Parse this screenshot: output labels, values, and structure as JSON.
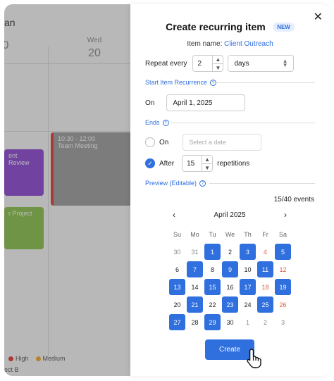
{
  "background": {
    "title_fragment": "an",
    "days": [
      {
        "name": "",
        "num": "0"
      },
      {
        "name": "Wed",
        "num": "20"
      }
    ],
    "events": [
      {
        "label": "ent Review"
      },
      {
        "label": "r Project"
      },
      {
        "time": "10:30 - 12:00",
        "label": "Team Meeting"
      }
    ],
    "legend": [
      {
        "label": "High",
        "color": "#e53935"
      },
      {
        "label": "Medium",
        "color": "#f9a825"
      }
    ],
    "footer": "ect B"
  },
  "dialog": {
    "title": "Create recurring item",
    "badge": "NEW",
    "item_prefix": "Item name:",
    "item_name": "Client Outreach",
    "repeat_label": "Repeat every",
    "repeat_value": "2",
    "repeat_unit": "days",
    "start_section": "Start Item Recurrence",
    "on_label": "On",
    "start_date": "April 1, 2025",
    "ends_section": "Ends",
    "ends_on_label": "On",
    "ends_on_placeholder": "Select a date",
    "after_label": "After",
    "after_value": "15",
    "repetitions_label": "repetitions",
    "preview_section": "Preview (Editable)",
    "events_count": "15/40 events",
    "month": "April 2025",
    "weekdays": [
      "Su",
      "Mo",
      "Tu",
      "We",
      "Th",
      "Fr",
      "Sa"
    ],
    "weeks": [
      [
        {
          "d": "30",
          "s": false,
          "m": true
        },
        {
          "d": "31",
          "s": false,
          "m": true
        },
        {
          "d": "1",
          "s": true
        },
        {
          "d": "2",
          "s": false
        },
        {
          "d": "3",
          "s": true
        },
        {
          "d": "4",
          "s": false,
          "w": true
        },
        {
          "d": "5",
          "s": true
        }
      ],
      [
        {
          "d": "6",
          "s": false
        },
        {
          "d": "7",
          "s": true
        },
        {
          "d": "8",
          "s": false
        },
        {
          "d": "9",
          "s": true
        },
        {
          "d": "10",
          "s": false
        },
        {
          "d": "11",
          "s": true
        },
        {
          "d": "12",
          "s": false,
          "w": true
        }
      ],
      [
        {
          "d": "13",
          "s": true
        },
        {
          "d": "14",
          "s": false
        },
        {
          "d": "15",
          "s": true
        },
        {
          "d": "16",
          "s": false
        },
        {
          "d": "17",
          "s": true
        },
        {
          "d": "18",
          "s": false,
          "w": true
        },
        {
          "d": "19",
          "s": true
        }
      ],
      [
        {
          "d": "20",
          "s": false
        },
        {
          "d": "21",
          "s": true
        },
        {
          "d": "22",
          "s": false
        },
        {
          "d": "23",
          "s": true
        },
        {
          "d": "24",
          "s": false
        },
        {
          "d": "25",
          "s": true
        },
        {
          "d": "26",
          "s": false,
          "w": true
        }
      ],
      [
        {
          "d": "27",
          "s": true
        },
        {
          "d": "28",
          "s": false
        },
        {
          "d": "29",
          "s": true
        },
        {
          "d": "30",
          "s": false
        },
        {
          "d": "1",
          "s": false,
          "m": true
        },
        {
          "d": "2",
          "s": false,
          "m": true
        },
        {
          "d": "3",
          "s": false,
          "m": true
        }
      ]
    ],
    "create_label": "Create",
    "accent": "#2f6fde"
  }
}
